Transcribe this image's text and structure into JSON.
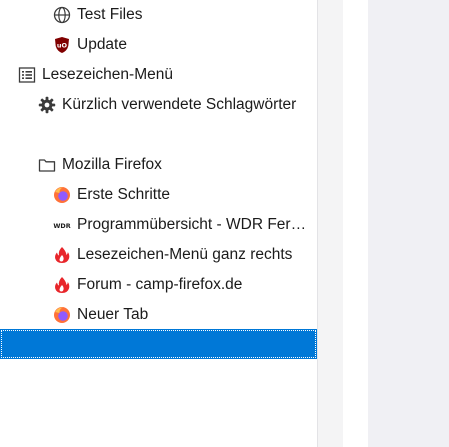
{
  "tree": {
    "items": [
      {
        "label": "Test Files",
        "icon": "globe-icon"
      },
      {
        "label": "Update",
        "icon": "ublock-shield-icon"
      },
      {
        "label": "Lesezeichen-Menü",
        "icon": "bookmarks-menu-icon"
      },
      {
        "label": "Kürzlich verwendete Schlagwörter",
        "icon": "gear-icon"
      },
      {
        "label": "Mozilla Firefox",
        "icon": "folder-icon"
      },
      {
        "label": "Erste Schritte",
        "icon": "firefox-logo-icon"
      },
      {
        "label": "Programmübersicht - WDR Fernsehen",
        "icon": "wdr-logo-icon"
      },
      {
        "label": "Lesezeichen-Menü ganz rechts",
        "icon": "flame-icon"
      },
      {
        "label": "Forum - camp-firefox.de",
        "icon": "flame-icon"
      },
      {
        "label": "Neuer Tab",
        "icon": "firefox-logo-icon"
      }
    ],
    "selected_row_label": ""
  },
  "colors": {
    "selection": "#0078d7",
    "ublock_red": "#800000",
    "flame_red": "#e8262b",
    "content_bg": "#f0f0f4"
  }
}
